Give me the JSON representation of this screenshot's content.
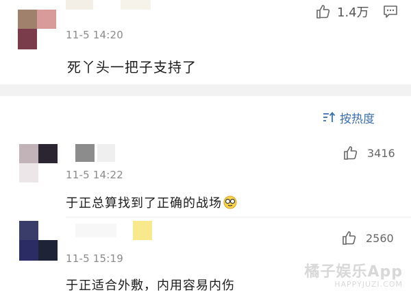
{
  "top_comment": {
    "time": "11-5 14:20",
    "text": "死丫头一把子支持了",
    "likes": "1.4万"
  },
  "sort": {
    "label": "按热度"
  },
  "comments": [
    {
      "time": "11-5 14:22",
      "text": "于正总算找到了正确的战场",
      "likes": "3416",
      "emoji": "glasses-face-emoji"
    },
    {
      "time": "11-5 15:19",
      "text": "于正适合外敷，内用容易内伤",
      "likes": "2560"
    }
  ],
  "watermark": {
    "title": "橘子娱乐App",
    "subtitle": "HAPPYJUZI.COM"
  },
  "colors": {
    "accent_blue": "#3a6fb0",
    "muted_text": "#8a8a8a",
    "band_gray": "#f2f2f2"
  }
}
